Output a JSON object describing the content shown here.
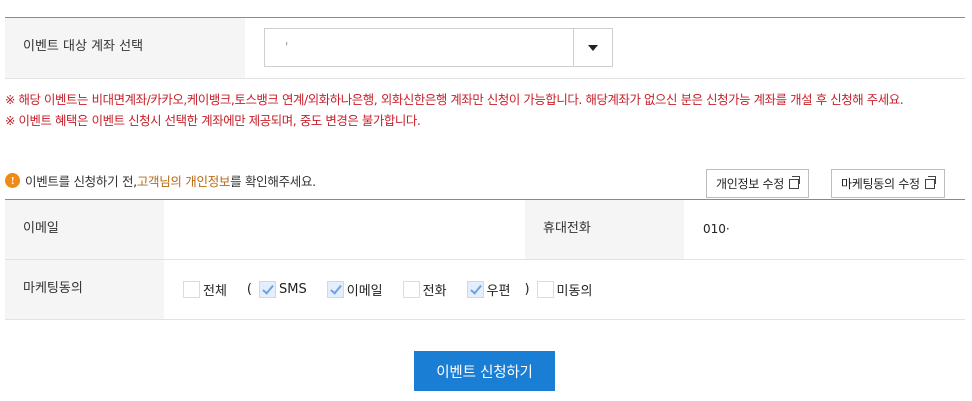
{
  "account": {
    "label": "이벤트 대상 계좌 선택",
    "selected_value": "'"
  },
  "notices": [
    "※ 해당 이벤트는 비대면계좌/카카오,케이뱅크,토스뱅크 연계/외화하나은행, 외화신한은행 계좌만 신청이 가능합니다. 해당계좌가 없으신 분은 신청가능 계좌를 개설 후 신청해 주세요.",
    "※ 이벤트 혜택은 이벤트 신청시 선택한 계좌에만 제공되며, 중도 변경은 불가합니다."
  ],
  "info": {
    "icon": "!",
    "text_before": "이벤트를 신청하기 전, ",
    "highlight": "고객님의 개인정보",
    "text_after": "를 확인해주세요."
  },
  "buttons": {
    "edit_personal": "개인정보 수정",
    "edit_marketing": "마케팅동의 수정",
    "submit": "이벤트 신청하기"
  },
  "profile": {
    "email_label": "이메일",
    "email_value": "",
    "phone_label": "휴대전화",
    "phone_value": "010·",
    "marketing_label": "마케팅동의"
  },
  "marketing_options": {
    "all": {
      "label": "전체",
      "checked": false
    },
    "open_paren": "(",
    "sms": {
      "label": "SMS",
      "checked": true
    },
    "email": {
      "label": "이메일",
      "checked": true
    },
    "phone": {
      "label": "전화",
      "checked": false
    },
    "post": {
      "label": "우편",
      "checked": true
    },
    "close_paren": ")",
    "none": {
      "label": "미동의",
      "checked": false
    }
  }
}
